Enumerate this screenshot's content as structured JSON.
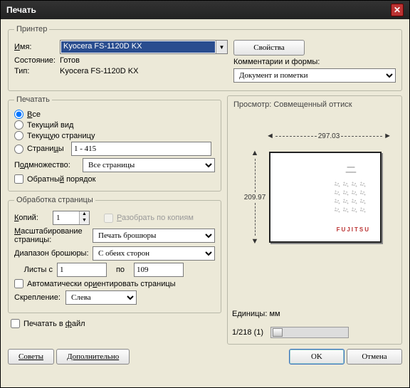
{
  "window": {
    "title": "Печать"
  },
  "printer": {
    "group_label": "Принтер",
    "name_label": "Имя:",
    "name_value": "Kyocera FS-1120D KX",
    "properties_btn": "Свойства",
    "state_label": "Состояние:",
    "state_value": "Готов",
    "type_label": "Тип:",
    "type_value": "Kyocera FS-1120D KX",
    "comments_label": "Комментарии и формы:",
    "comments_value": "Документ и пометки"
  },
  "range": {
    "group_label": "Печатать",
    "all": "Все",
    "current_view": "Текущий вид",
    "current_page": "Текущую страницу",
    "pages_label": "Страницы",
    "pages_value": "1 - 415",
    "subset_label": "Подмножество:",
    "subset_value": "Все страницы",
    "reverse": "Обратный порядок"
  },
  "handling": {
    "group_label": "Обработка страницы",
    "copies_label": "Копий:",
    "copies_value": "1",
    "collate": "Разобрать по копиям",
    "scaling_label": "Масштабирование страницы:",
    "scaling_value": "Печать брошюры",
    "booklet_label": "Диапазон брошюры:",
    "booklet_value": "С обеих сторон",
    "sheets_from": "Листы с",
    "sheets_from_val": "1",
    "sheets_to": "по",
    "sheets_to_val": "109",
    "autorotate": "Автоматически ориентировать страницы",
    "binding_label": "Скрепление:",
    "binding_value": "Слева"
  },
  "extra": {
    "print_to_file": "Печатать в файл"
  },
  "preview": {
    "group_label": "Просмотр: Совмещенный оттиск",
    "width": "297.03",
    "height": "209.97",
    "units": "Единицы: мм",
    "pager": "1/218 (1)",
    "brand": "FUJITSU"
  },
  "buttons": {
    "tips": "Советы",
    "advanced": "Дополнительно",
    "ok": "OK",
    "cancel": "Отмена"
  }
}
